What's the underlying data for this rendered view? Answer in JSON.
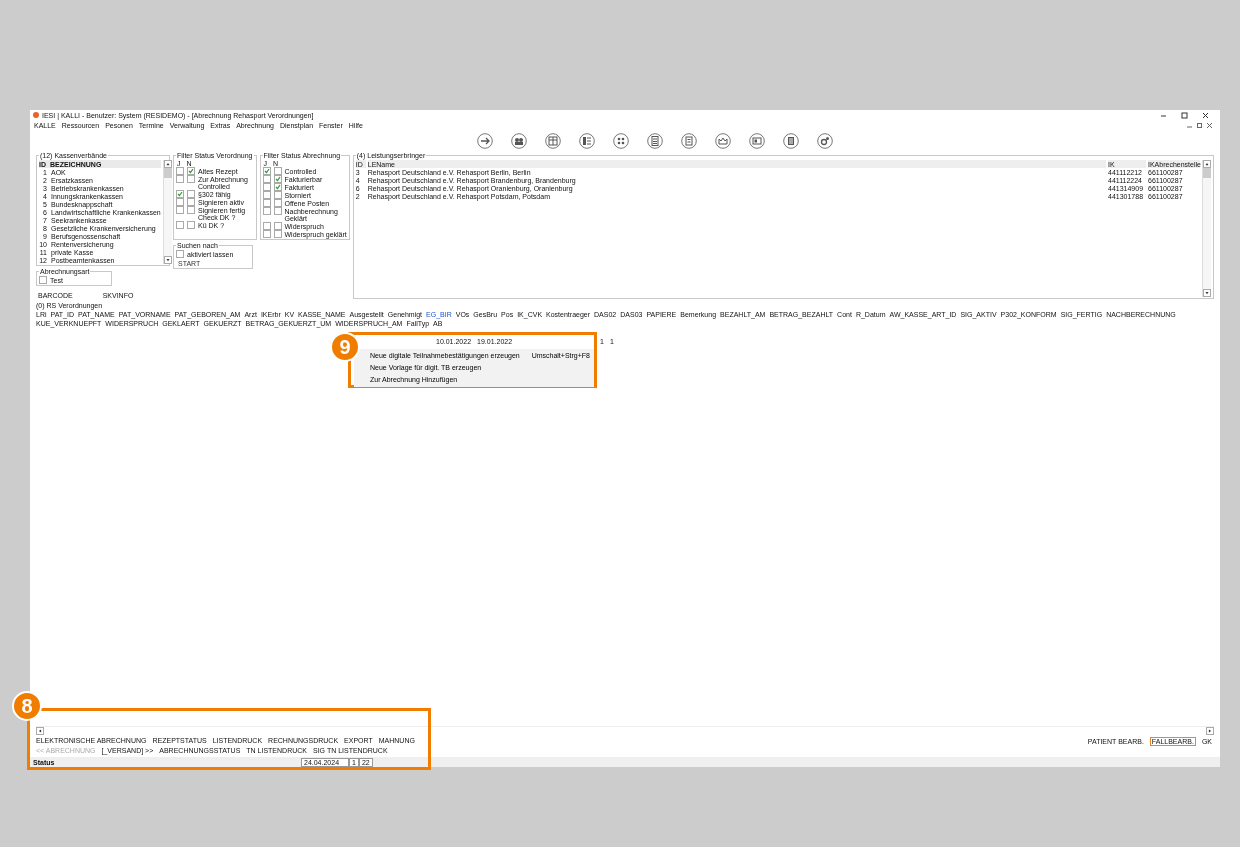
{
  "window": {
    "title": "IESI | KALLI - Benutzer: System (RESIDEMO) - [Abrechnung Rehasport Verordnungen]"
  },
  "menu": [
    "KALLE",
    "Ressourcen",
    "Pesonen",
    "Termine",
    "Verwaltung",
    "Extras",
    "Abrechnung",
    "Dienstplan",
    "Fenster",
    "Hilfe"
  ],
  "kassen": {
    "title": "(12) Kassenverbände",
    "header": [
      "ID",
      "BEZEICHNUNG"
    ],
    "rows": [
      {
        "id": "1",
        "name": "AOK"
      },
      {
        "id": "2",
        "name": "Ersatzkassen"
      },
      {
        "id": "3",
        "name": "Betriebskrankenkassen"
      },
      {
        "id": "4",
        "name": "Innungskrankenkassen"
      },
      {
        "id": "5",
        "name": "Bundesknappschaft"
      },
      {
        "id": "6",
        "name": "Landwirtschaftliche Krankenkassen"
      },
      {
        "id": "7",
        "name": "Seekrankenkasse"
      },
      {
        "id": "8",
        "name": "Gesetzliche Krankenversicherung"
      },
      {
        "id": "9",
        "name": "Berufsgenossenschaft"
      },
      {
        "id": "10",
        "name": "Rentenversicherung"
      },
      {
        "id": "11",
        "name": "private Kasse"
      },
      {
        "id": "12",
        "name": "Postbeamtenkassen"
      }
    ]
  },
  "filter_verordnung": {
    "title": "Filter Status Verordnung",
    "cols": [
      "J",
      "N"
    ],
    "items": [
      {
        "kind": "check",
        "label": "Altes Rezept",
        "j": false,
        "n": true
      },
      {
        "kind": "check",
        "label": "Zur Abrechnung",
        "j": false,
        "n": false
      },
      {
        "kind": "plain",
        "label": "Controlled"
      },
      {
        "kind": "check",
        "label": "§302 fähig",
        "j": true,
        "n": false
      },
      {
        "kind": "check",
        "label": "Signieren aktiv",
        "j": false,
        "n": false
      },
      {
        "kind": "check",
        "label": "Signieren fertig",
        "j": false,
        "n": false
      },
      {
        "kind": "plain",
        "label": "Check DK ?"
      },
      {
        "kind": "check",
        "label": "Kü DK ?",
        "j": false,
        "n": false
      }
    ]
  },
  "filter_abrechnung": {
    "title": "Filter Status Abrechnung",
    "cols": [
      "J",
      "N"
    ],
    "items": [
      {
        "kind": "check",
        "label": "Controlled",
        "j": true,
        "n": false
      },
      {
        "kind": "check",
        "label": "Fakturierbar",
        "j": false,
        "n": true
      },
      {
        "kind": "check",
        "label": "Fakturiert",
        "j": false,
        "n": true
      },
      {
        "kind": "check",
        "label": "Storniert",
        "j": false,
        "n": false
      },
      {
        "kind": "check",
        "label": "Offene Posten",
        "j": false,
        "n": false
      },
      {
        "kind": "check",
        "label": "Nachberechnung",
        "j": false,
        "n": false
      },
      {
        "kind": "plain",
        "label": "Geklärt"
      },
      {
        "kind": "check",
        "label": "Widerspruch",
        "j": false,
        "n": false
      },
      {
        "kind": "check",
        "label": "Widerspruch geklärt",
        "j": false,
        "n": false
      }
    ]
  },
  "suchen": {
    "title": "Suchen nach",
    "checkbox": {
      "label": "aktiviert lassen",
      "checked": false
    },
    "button": "START"
  },
  "abrechnungsart": {
    "title": "Abrechnungsart",
    "checkbox": {
      "label": "Test",
      "checked": false
    }
  },
  "links": [
    "BARCODE",
    "SKVINFO"
  ],
  "leistungserbringer": {
    "title": "(4) Leistungserbringer",
    "columns": [
      "ID",
      "LEName",
      "IK",
      "IKAbrechenstelle"
    ],
    "rows": [
      [
        "3",
        "Rehasport Deutschland e.V. Rehasport Berlin, Berlin",
        "441112212",
        "661100287"
      ],
      [
        "4",
        "Rehasport Deutschland e.V. Rehasport Brandenburg, Brandenburg",
        "441112224",
        "661100287"
      ],
      [
        "6",
        "Rehasport Deutschland e.V. Rehasport Oranienburg, Oranienburg",
        "441314909",
        "661100287"
      ],
      [
        "2",
        "Rehasport Deutschland e.V. Rehasport Potsdam, Potsdam",
        "441301788",
        "661100287"
      ]
    ]
  },
  "verordnungen": {
    "title": "(0) RS Verordnungen",
    "columns": [
      "LRi",
      "PAT_ID",
      "PAT_NAME",
      "PAT_VORNAME",
      "PAT_GEBOREN_AM",
      "Arzt",
      "IKErbr",
      "KV",
      "KASSE_NAME",
      "Ausgestellt",
      "Genehmigt",
      "EG_BIR",
      "VOs",
      "GesBru",
      "Pos",
      "IK_CVK",
      "Kostentraeger",
      "DAS02",
      "DAS03",
      "PAPIERE",
      "Bemerkung",
      "BEZAHLT_AM",
      "BETRAG_BEZAHLT",
      "Cont",
      "R_Datum",
      "AW_KASSE_ART_ID",
      "SIG_AKTIV",
      "P302_KONFORM",
      "SIG_FERTIG",
      "NACHBERECHNUNG",
      "KUE_VERKNUEPFT",
      "WIDERSPRUCH",
      "GEKLAERT",
      "GEKUERZT",
      "BETRAG_GEKUERZT_UM",
      "WIDERSPRUCH_AM",
      "FallTyp",
      "AB"
    ],
    "row": [
      "10.01.2022",
      "19.01.2022",
      "1",
      "1"
    ]
  },
  "context_menu": {
    "items": [
      {
        "label": "Neue digitale Teilnahmebestätigungen erzeugen",
        "shortcut": "Umschalt+Strg+F8"
      },
      {
        "label": "Neue Vorlage für digit. TB erzeugen"
      },
      {
        "label": "Zur Abrechnung Hinzufügen"
      }
    ]
  },
  "buttons_row1": [
    {
      "label": "ELEKTRONISCHE ABRECHNUNG",
      "disabled": false
    },
    {
      "label": "REZEPTSTATUS",
      "disabled": false
    },
    {
      "label": "LISTENDRUCK",
      "disabled": false
    },
    {
      "label": "RECHNUNGSDRUCK",
      "disabled": false
    },
    {
      "label": "EXPORT",
      "disabled": false
    },
    {
      "label": "MAHNUNG",
      "disabled": false
    }
  ],
  "buttons_row2": [
    {
      "label": "<< ABRECHNUNG",
      "disabled": true
    },
    {
      "label": "[_VERSAND] >>",
      "disabled": false
    },
    {
      "label": "ABRECHNUNGSSTATUS",
      "disabled": false
    },
    {
      "label": "TN LISTENDRUCK",
      "disabled": false
    },
    {
      "label": "SIG TN LISTENDRUCK",
      "disabled": false
    }
  ],
  "right_buttons": [
    {
      "label": "PATIENT BEARB.",
      "selected": false
    },
    {
      "label": "FALLBEARB.",
      "selected": true
    },
    {
      "label": "GK",
      "selected": false
    }
  ],
  "status_bar": {
    "label": "Status",
    "date": "24.04.2024",
    "field": "1",
    "time": "22"
  },
  "callouts": [
    {
      "number": "8"
    },
    {
      "number": "9"
    }
  ]
}
